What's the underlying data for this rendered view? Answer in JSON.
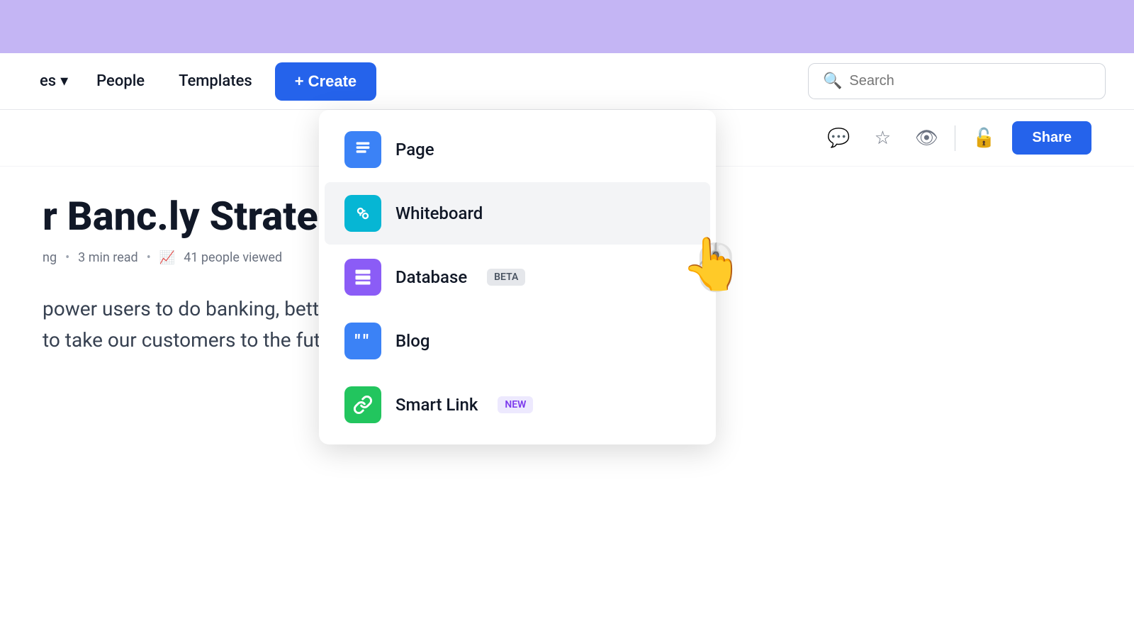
{
  "topBanner": {},
  "navbar": {
    "pages_label": "es",
    "people_label": "People",
    "templates_label": "Templates",
    "create_label": "+ Create",
    "search_placeholder": "Search"
  },
  "toolbar": {
    "share_label": "Share"
  },
  "document": {
    "title": "r Banc.ly Strategy",
    "author": "ng",
    "read_time": "3 min read",
    "viewers": "41 people viewed",
    "body_line1": "power users to do banking, better than ever. We are a credit card company",
    "body_line2": "to take our customers to the future."
  },
  "dropdown": {
    "items": [
      {
        "id": "page",
        "label": "Page",
        "icon": "page",
        "badge": null
      },
      {
        "id": "whiteboard",
        "label": "Whiteboard",
        "icon": "whiteboard",
        "badge": null
      },
      {
        "id": "database",
        "label": "Database",
        "icon": "database",
        "badge": "BETA",
        "badge_type": "beta"
      },
      {
        "id": "blog",
        "label": "Blog",
        "icon": "blog",
        "badge": null
      },
      {
        "id": "smartlink",
        "label": "Smart Link",
        "icon": "smartlink",
        "badge": "NEW",
        "badge_type": "new"
      }
    ]
  }
}
